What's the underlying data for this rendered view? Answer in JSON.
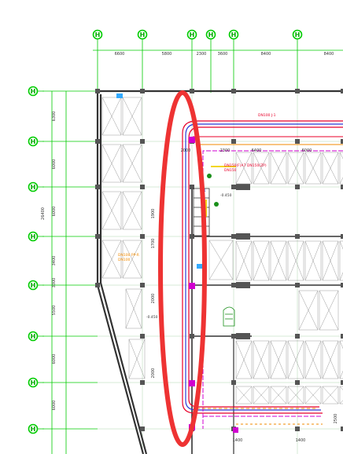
{
  "drawing": {
    "grid_label": "H",
    "top_dimensions": [
      "6600",
      "5800",
      "2300",
      "3600",
      "8400",
      "8400"
    ],
    "left_dimensions": [
      "6300",
      "6000",
      "6000",
      "3400",
      "3300",
      "5500",
      "6000",
      "6000"
    ],
    "left_total": "26400",
    "plan_dims": {
      "d1": "2000",
      "d2": "2300",
      "d3": "6400",
      "d4": "6000",
      "d5": "1900",
      "d6": "1700",
      "d7": "2000",
      "d8": "2000",
      "d9": "1400",
      "d10": "1400",
      "d11": "2500"
    }
  },
  "colors": {
    "grid": "#00cc00",
    "wall": "#333333",
    "pipe_red": "#e8002a",
    "pipe_blue": "#2a3cd8",
    "pipe_orange": "#f08a00",
    "pipe_magenta": "#d000d0",
    "pipe_yellow": "#f0d000",
    "highlight": "#ee3333",
    "dim": "#00aa00"
  },
  "markup": {
    "highlight_shape": "red-ellipse"
  }
}
